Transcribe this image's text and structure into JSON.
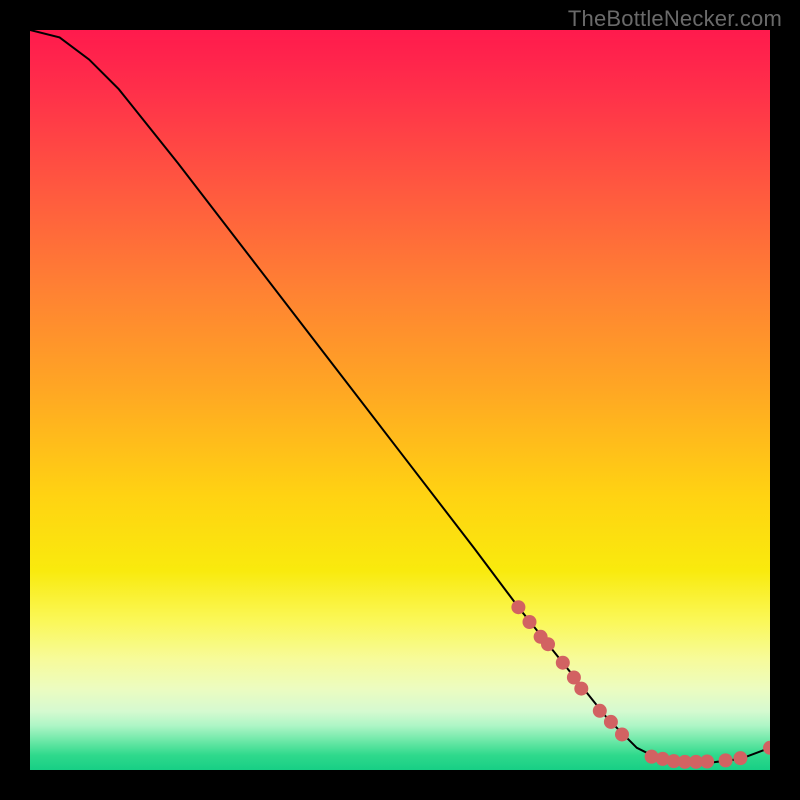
{
  "watermark": "TheBottleNecker.com",
  "chart_data": {
    "type": "line",
    "title": "",
    "xlabel": "",
    "ylabel": "",
    "xlim": [
      0,
      100
    ],
    "ylim": [
      0,
      100
    ],
    "curve": [
      {
        "x": 0,
        "y": 100
      },
      {
        "x": 4,
        "y": 99
      },
      {
        "x": 8,
        "y": 96
      },
      {
        "x": 12,
        "y": 92
      },
      {
        "x": 20,
        "y": 82
      },
      {
        "x": 30,
        "y": 69
      },
      {
        "x": 40,
        "y": 56
      },
      {
        "x": 50,
        "y": 43
      },
      {
        "x": 60,
        "y": 30
      },
      {
        "x": 66,
        "y": 22
      },
      {
        "x": 70,
        "y": 17
      },
      {
        "x": 74,
        "y": 12
      },
      {
        "x": 78,
        "y": 7
      },
      {
        "x": 82,
        "y": 3
      },
      {
        "x": 85,
        "y": 1.5
      },
      {
        "x": 88,
        "y": 1
      },
      {
        "x": 92,
        "y": 1
      },
      {
        "x": 96,
        "y": 1.5
      },
      {
        "x": 100,
        "y": 3
      }
    ],
    "markers": [
      {
        "x": 66,
        "y": 22
      },
      {
        "x": 67.5,
        "y": 20
      },
      {
        "x": 69,
        "y": 18
      },
      {
        "x": 70,
        "y": 17
      },
      {
        "x": 72,
        "y": 14.5
      },
      {
        "x": 73.5,
        "y": 12.5
      },
      {
        "x": 74.5,
        "y": 11
      },
      {
        "x": 77,
        "y": 8
      },
      {
        "x": 78.5,
        "y": 6.5
      },
      {
        "x": 80,
        "y": 4.8
      },
      {
        "x": 84,
        "y": 1.8
      },
      {
        "x": 85.5,
        "y": 1.5
      },
      {
        "x": 87,
        "y": 1.2
      },
      {
        "x": 88.5,
        "y": 1.1
      },
      {
        "x": 90,
        "y": 1.1
      },
      {
        "x": 91.5,
        "y": 1.15
      },
      {
        "x": 94,
        "y": 1.3
      },
      {
        "x": 96,
        "y": 1.6
      },
      {
        "x": 100,
        "y": 3
      }
    ]
  }
}
